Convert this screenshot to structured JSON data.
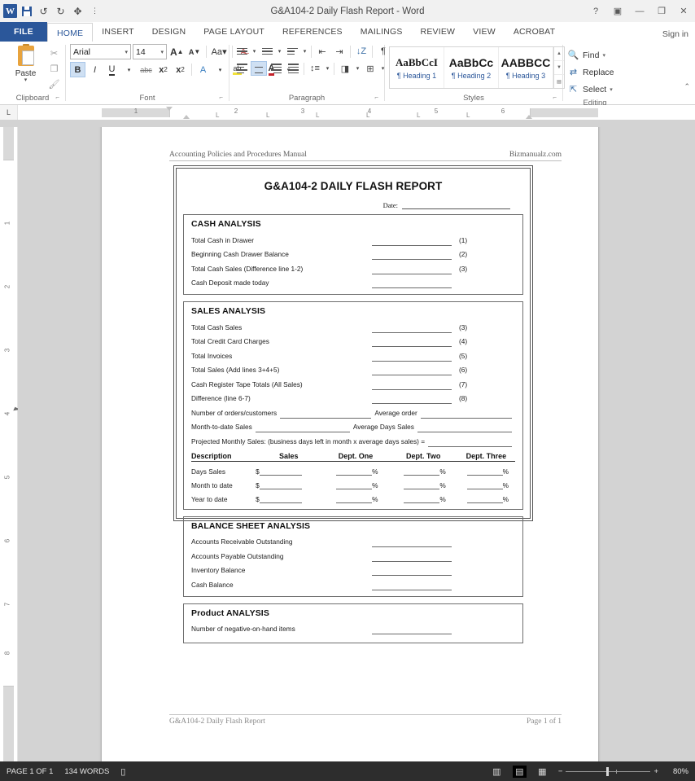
{
  "window": {
    "title": "G&A104-2 Daily Flash Report - Word",
    "app_logo": "word-logo",
    "quick_access": [
      "save-icon",
      "undo-icon",
      "redo-icon",
      "touch-mode-icon",
      "customize-qat-icon"
    ],
    "controls": {
      "help": "?",
      "ribbon_display": "▣",
      "minimize": "—",
      "restore": "❐",
      "close": "✕"
    },
    "sign_in": "Sign in"
  },
  "tabs": [
    {
      "label": "FILE",
      "active": false
    },
    {
      "label": "HOME",
      "active": true
    },
    {
      "label": "INSERT",
      "active": false
    },
    {
      "label": "DESIGN",
      "active": false
    },
    {
      "label": "PAGE LAYOUT",
      "active": false
    },
    {
      "label": "REFERENCES",
      "active": false
    },
    {
      "label": "MAILINGS",
      "active": false
    },
    {
      "label": "REVIEW",
      "active": false
    },
    {
      "label": "VIEW",
      "active": false
    },
    {
      "label": "ACROBAT",
      "active": false
    }
  ],
  "ribbon": {
    "clipboard": {
      "label": "Clipboard",
      "paste": "Paste",
      "cut": "cut-icon",
      "copy": "copy-icon",
      "format_painter": "format-painter-icon"
    },
    "font": {
      "label": "Font",
      "font_name": "Arial",
      "font_size": "14",
      "grow": "A",
      "shrink": "A",
      "change_case": "Aa",
      "clear_formatting": "clear-formatting-icon",
      "bold": "B",
      "italic": "I",
      "underline": "U",
      "strikethrough": "abc",
      "subscript": "x",
      "superscript": "x",
      "text_effects": "A",
      "highlight": "highlight-icon",
      "font_color": "A"
    },
    "paragraph": {
      "label": "Paragraph",
      "bullets": "bullets-icon",
      "numbering": "numbering-icon",
      "multilevel": "multilevel-list-icon",
      "decrease_indent": "decrease-indent-icon",
      "increase_indent": "increase-indent-icon",
      "sort": "sort-icon",
      "show_marks": "¶",
      "align_left": "align-left-icon",
      "align_center": "align-center-icon",
      "align_right": "align-right-icon",
      "justify": "justify-icon",
      "line_spacing": "line-spacing-icon",
      "shading": "shading-icon",
      "borders": "borders-icon"
    },
    "styles": {
      "label": "Styles",
      "items": [
        {
          "preview": "AaBbCcI",
          "name": "Heading 1"
        },
        {
          "preview": "AaBbCc",
          "name": "Heading 2"
        },
        {
          "preview": "AABBCC",
          "name": "Heading 3"
        }
      ]
    },
    "editing": {
      "label": "Editing",
      "find": "Find",
      "replace": "Replace",
      "select": "Select"
    }
  },
  "ruler": {
    "corner": "L",
    "h_ticks": [
      "1",
      "2",
      "3",
      "4",
      "5",
      "6"
    ],
    "v_ticks": [
      "1",
      "2",
      "3",
      "4",
      "5",
      "6",
      "7",
      "8"
    ]
  },
  "document": {
    "header_left": "Accounting Policies and Procedures Manual",
    "header_right": "Bizmanualz.com",
    "footer_left": "G&A104-2 Daily Flash Report",
    "footer_right": "Page 1 of 1",
    "form_title": "G&A104-2 DAILY FLASH REPORT",
    "date_label": "Date:",
    "sections": {
      "cash": {
        "title": "CASH ANALYSIS",
        "rows": [
          {
            "label": "Total Cash in Drawer",
            "num": "(1)"
          },
          {
            "label": "Beginning Cash Drawer Balance",
            "num": "(2)"
          },
          {
            "label": "Total Cash Sales (Difference line 1-2)",
            "num": "(3)"
          },
          {
            "label": "Cash Deposit made today",
            "num": ""
          }
        ]
      },
      "sales": {
        "title": "SALES ANALYSIS",
        "rows": [
          {
            "label": "Total Cash Sales",
            "num": "(3)"
          },
          {
            "label": "Total Credit Card Charges",
            "num": "(4)"
          },
          {
            "label": "Total Invoices",
            "num": "(5)"
          },
          {
            "label": "Total Sales (Add lines 3+4+5)",
            "num": "(6)"
          },
          {
            "label": "Cash Register Tape Totals (All Sales)",
            "num": "(7)"
          },
          {
            "label": "Difference (line 6-7)",
            "num": "(8)"
          }
        ],
        "pair_rows": [
          {
            "left": "Number of orders/customers",
            "right": "Average order"
          },
          {
            "left": "Month-to-date Sales",
            "right": "Average Days Sales"
          }
        ],
        "projected": "Projected Monthly Sales: (business days left in month x average days sales) =",
        "table": {
          "headers": [
            "Description",
            "Sales",
            "Dept. One",
            "Dept. Two",
            "Dept. Three"
          ],
          "rows": [
            {
              "label": "Days Sales",
              "currency": "$",
              "pct": "%"
            },
            {
              "label": "Month to date",
              "currency": "$",
              "pct": "%"
            },
            {
              "label": "Year to date",
              "currency": "$",
              "pct": "%"
            }
          ]
        }
      },
      "balance": {
        "title": "BALANCE SHEET ANALYSIS",
        "rows": [
          {
            "label": "Accounts Receivable Outstanding",
            "num": ""
          },
          {
            "label": "Accounts Payable Outstanding",
            "num": ""
          },
          {
            "label": "Inventory Balance",
            "num": ""
          },
          {
            "label": "Cash Balance",
            "num": ""
          }
        ]
      },
      "product": {
        "title": "Product ANALYSIS",
        "rows": [
          {
            "label": "Number of negative-on-hand items",
            "num": ""
          }
        ]
      }
    }
  },
  "status_bar": {
    "page": "PAGE 1 OF 1",
    "words": "134 WORDS",
    "proofing": "proofing-icon",
    "read_mode": "read-mode-icon",
    "print_layout": "print-layout-icon",
    "web_layout": "web-layout-icon",
    "zoom_out": "−",
    "zoom_in": "+",
    "zoom_level": "80%"
  },
  "colors": {
    "word_blue": "#2b579a",
    "status_bg": "#2d2d2d",
    "canvas_bg": "#d3d3d3"
  }
}
